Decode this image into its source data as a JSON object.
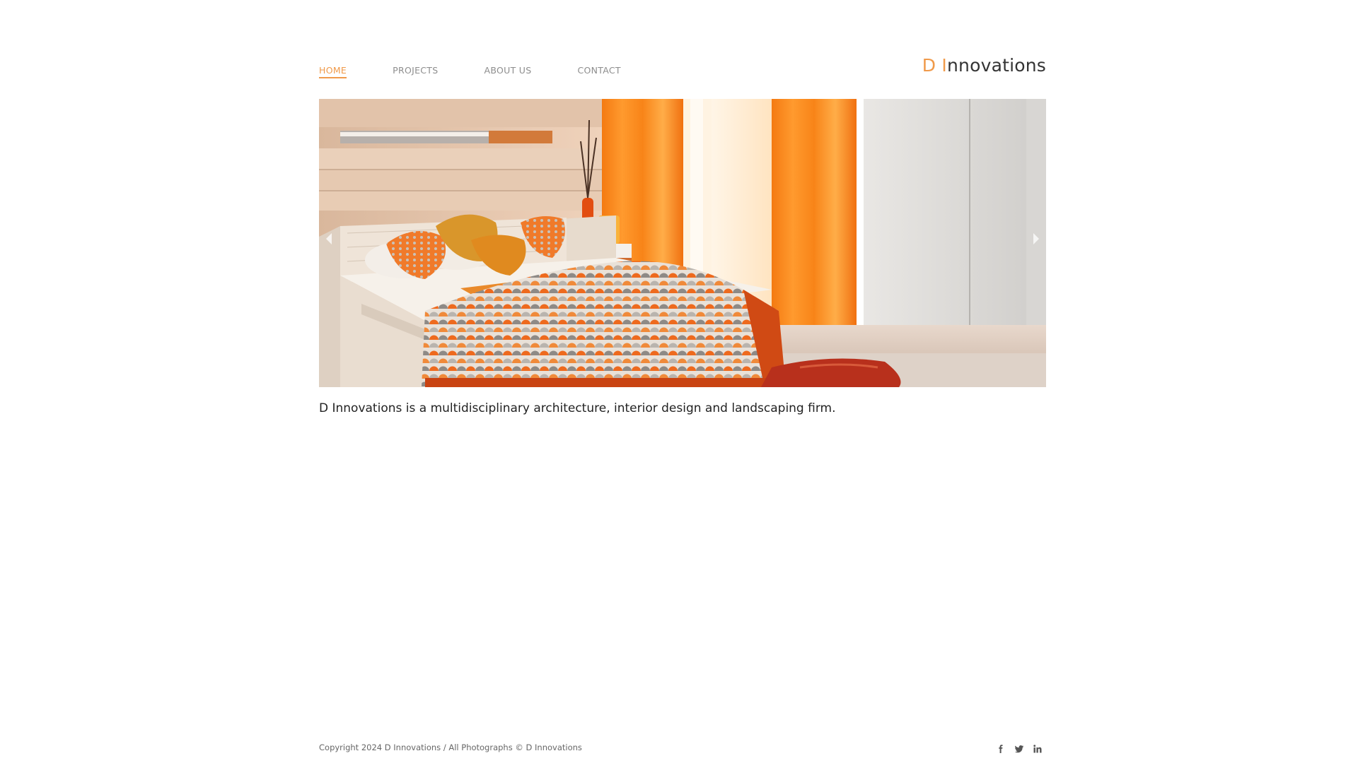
{
  "nav": {
    "items": [
      {
        "label": "HOME",
        "active": true
      },
      {
        "label": "PROJECTS",
        "active": false
      },
      {
        "label": "ABOUT US",
        "active": false
      },
      {
        "label": "CONTACT",
        "active": false
      }
    ]
  },
  "logo": {
    "part1": "D ",
    "part2": "I",
    "part3": "nnovations"
  },
  "hero": {
    "image": "bedroom-interior-photo",
    "prev_icon": "chevron-left-icon",
    "next_icon": "chevron-right-icon"
  },
  "tagline": "D Innovations is a multidisciplinary architecture, interior design and landscaping firm.",
  "footer": {
    "copyright": "Copyright 2024 D Innovations / All Photographs © D Innovations",
    "social": [
      "facebook-icon",
      "twitter-icon",
      "linkedin-icon"
    ]
  },
  "colors": {
    "accent": "#f09a4a",
    "nav_text": "#8d8d8d",
    "body_text": "#222222"
  }
}
